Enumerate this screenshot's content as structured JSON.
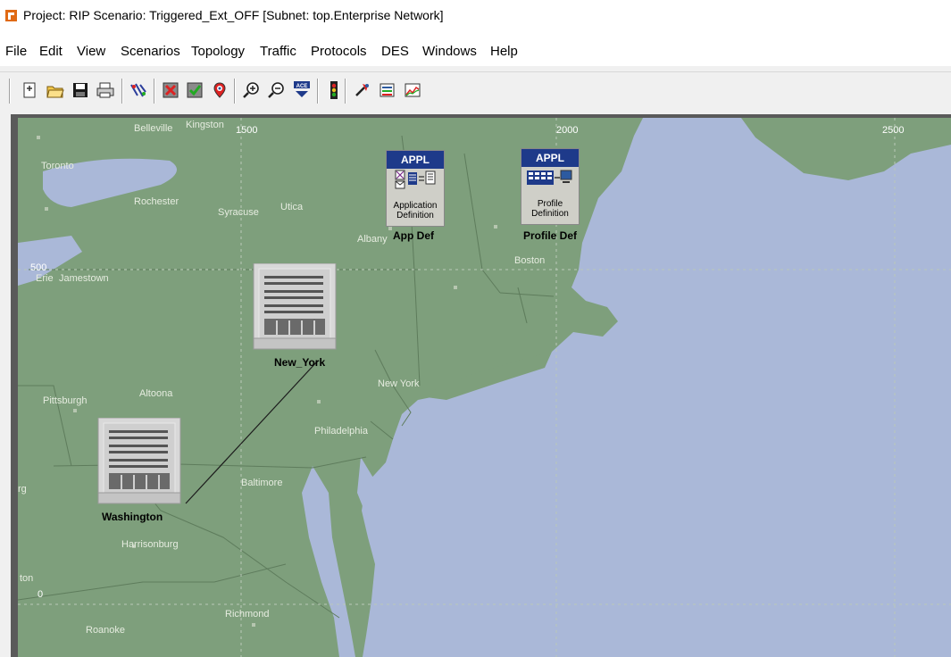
{
  "window": {
    "title": "Project: RIP Scenario: Triggered_Ext_OFF  [Subnet: top.Enterprise Network]"
  },
  "menu": [
    "File",
    "Edit",
    "View",
    "Scenarios",
    "Topology",
    "Traffic",
    "Protocols",
    "DES",
    "Windows",
    "Help"
  ],
  "toolbar": {
    "buttons": [
      "new-icon",
      "open-folder-icon",
      "save-icon",
      "print-icon",
      "object-palette-icon",
      "verify-links-icon",
      "fail-node-icon",
      "recover-node-icon",
      "zoom-in-icon",
      "zoom-out-icon",
      "ace-icon",
      "run-simulation-icon",
      "view-results-icon",
      "web-report-icon",
      "graph-icon"
    ]
  },
  "map": {
    "coordinates": {
      "x1500": "1500",
      "x2000": "2000",
      "x2500": "2500",
      "y500": "500",
      "y0": "0"
    },
    "cities": [
      "Belleville",
      "Kingston",
      "Toronto",
      "Rochester",
      "Syracuse",
      "Utica",
      "Albany",
      "Boston",
      "Erie",
      "Jamestown",
      "Pittsburgh",
      "Altoona",
      "New York",
      "Philadelphia",
      "Baltimore",
      "Harrisonburg",
      "Richmond",
      "Roanoke",
      "rg",
      "ton"
    ],
    "colors": {
      "land": "#7e9f7c",
      "water": "#aab8d8",
      "border": "#5e7c5c"
    }
  },
  "nodes": {
    "app_def": {
      "head": "APPL",
      "caption_line1": "Application",
      "caption_line2": "Definition",
      "label": "App Def"
    },
    "profile_def": {
      "head": "APPL",
      "caption_line1": "Profile",
      "caption_line2": "Definition",
      "label": "Profile Def"
    },
    "new_york": {
      "label": "New_York"
    },
    "washington": {
      "label": "Washington"
    }
  }
}
